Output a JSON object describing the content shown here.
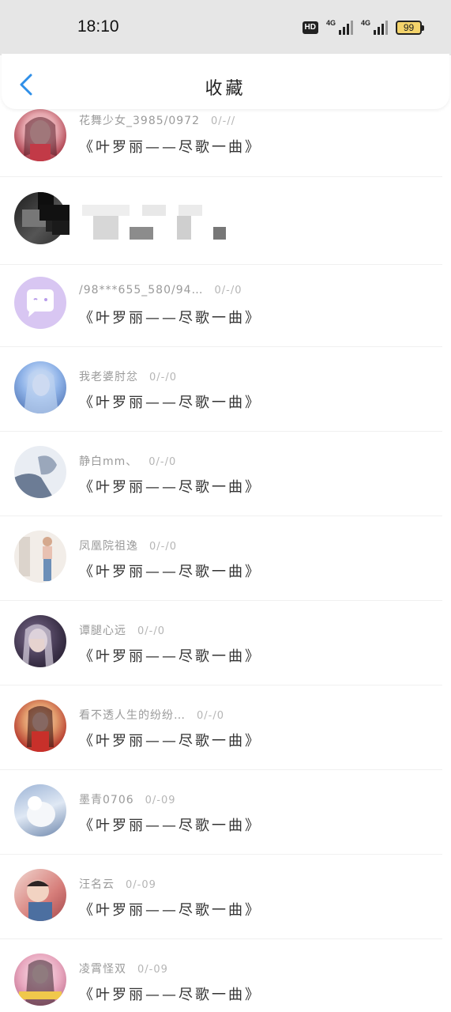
{
  "status_bar": {
    "time": "18:10",
    "hd_label": "HD",
    "sig1_label": "4G",
    "sig2_label": "4G",
    "battery": "99",
    "battery_color": "#f3d36b"
  },
  "header": {
    "title": "收藏",
    "back_icon": "chevron-left-icon"
  },
  "colors": {
    "accent": "#2f8fe8"
  },
  "favorites": [
    {
      "user": "花舞少女_3985/0972",
      "date": "0/-//",
      "song": "《叶罗丽——尽歌一曲》"
    },
    {
      "user": "",
      "date": "",
      "song": ""
    },
    {
      "user": "/98***655_580/94…",
      "date": "0/-/0",
      "song": "《叶罗丽——尽歌一曲》"
    },
    {
      "user": "我老婆肘忿",
      "date": "0/-/0",
      "song": "《叶罗丽——尽歌一曲》"
    },
    {
      "user": "静白mm、",
      "date": "0/-/0",
      "song": "《叶罗丽——尽歌一曲》"
    },
    {
      "user": "凤凰院祖逸",
      "date": "0/-/0",
      "song": "《叶罗丽——尽歌一曲》"
    },
    {
      "user": "谭腿心远",
      "date": "0/-/0",
      "song": "《叶罗丽——尽歌一曲》"
    },
    {
      "user": "看不透人生的纷纷…",
      "date": "0/-/0",
      "song": "《叶罗丽——尽歌一曲》"
    },
    {
      "user": "墨青0706",
      "date": "0/-09",
      "song": "《叶罗丽——尽歌一曲》"
    },
    {
      "user": "汪名云",
      "date": "0/-09",
      "song": "《叶罗丽——尽歌一曲》"
    },
    {
      "user": "凌霄怪双",
      "date": "0/-09",
      "song": "《叶罗丽——尽歌一曲》"
    }
  ]
}
